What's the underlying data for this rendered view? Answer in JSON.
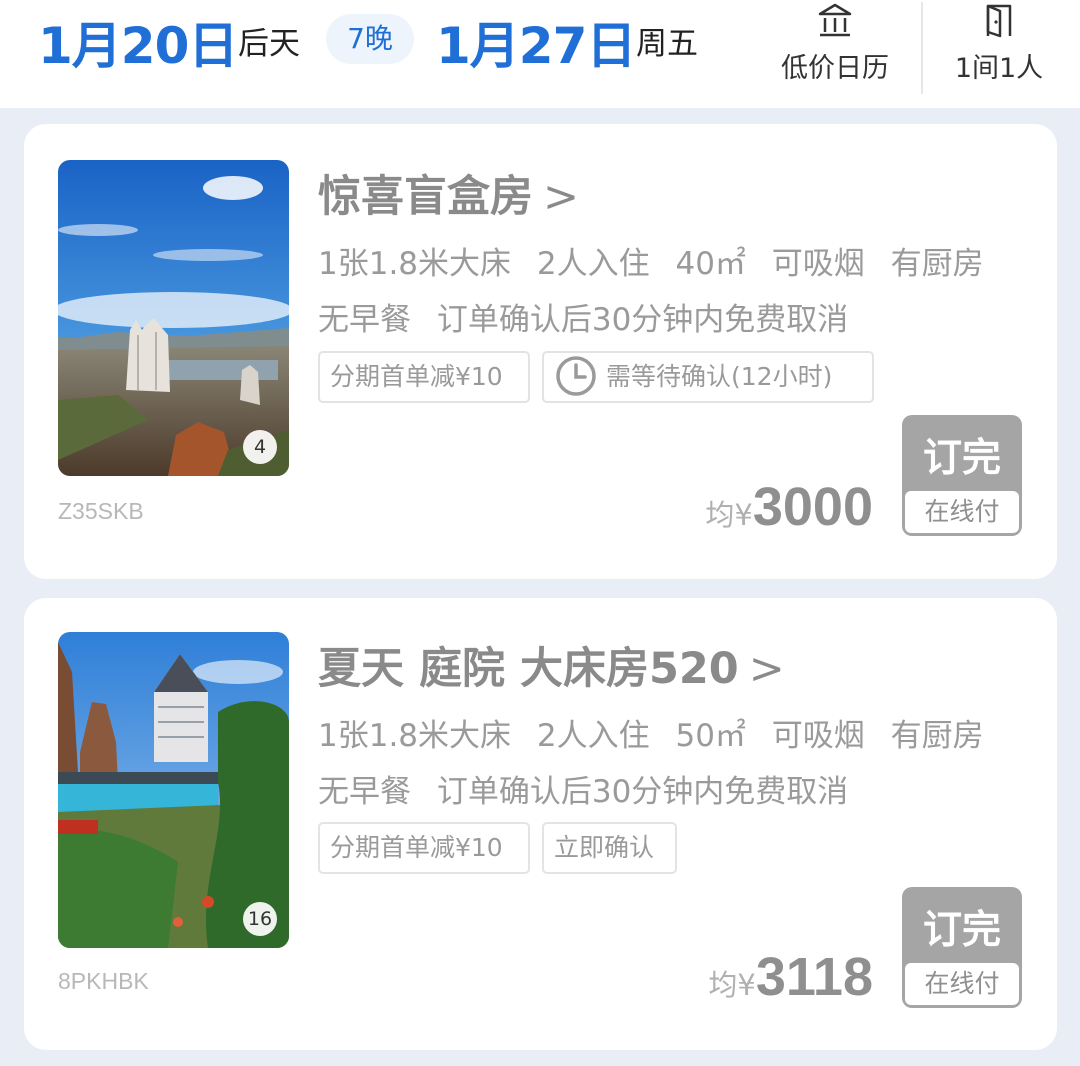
{
  "header": {
    "checkin_date": "1月20日",
    "checkin_day": "后天",
    "nights": "7晚",
    "checkout_date": "1月27日",
    "checkout_day": "周五",
    "calendar_label": "低价日历",
    "rooms_label": "1间1人"
  },
  "rooms": [
    {
      "name": "惊喜盲盒房",
      "chevron": ">",
      "photo_count": "4",
      "code": "Z35SKB",
      "specs_line1": [
        "1张1.8米大床",
        "2人入住",
        "40㎡",
        "可吸烟",
        "有厨房"
      ],
      "specs_line2": [
        "无早餐",
        "订单确认后30分钟内免费取消"
      ],
      "tags": [
        "分期首单减¥10",
        "需等待确认(12小时)"
      ],
      "price_prefix": "均¥",
      "price": "3000",
      "book_label": "订完",
      "pay_label": "在线付"
    },
    {
      "name": "夏天 庭院 大床房520",
      "chevron": ">",
      "photo_count": "16",
      "code": "8PKHBK",
      "specs_line1": [
        "1张1.8米大床",
        "2人入住",
        "50㎡",
        "可吸烟",
        "有厨房"
      ],
      "specs_line2": [
        "无早餐",
        "订单确认后30分钟内免费取消"
      ],
      "tags": [
        "分期首单减¥10",
        "立即确认"
      ],
      "price_prefix": "均¥",
      "price": "3118",
      "book_label": "订完",
      "pay_label": "在线付"
    }
  ],
  "colors": {
    "accent": "#1f6fd6",
    "sold_out_gray": "#a5a5a5",
    "background": "#e9eef6"
  },
  "icons": {
    "calendar": "bank-building-icon",
    "rooms": "door-icon",
    "clock": "clock-icon"
  }
}
